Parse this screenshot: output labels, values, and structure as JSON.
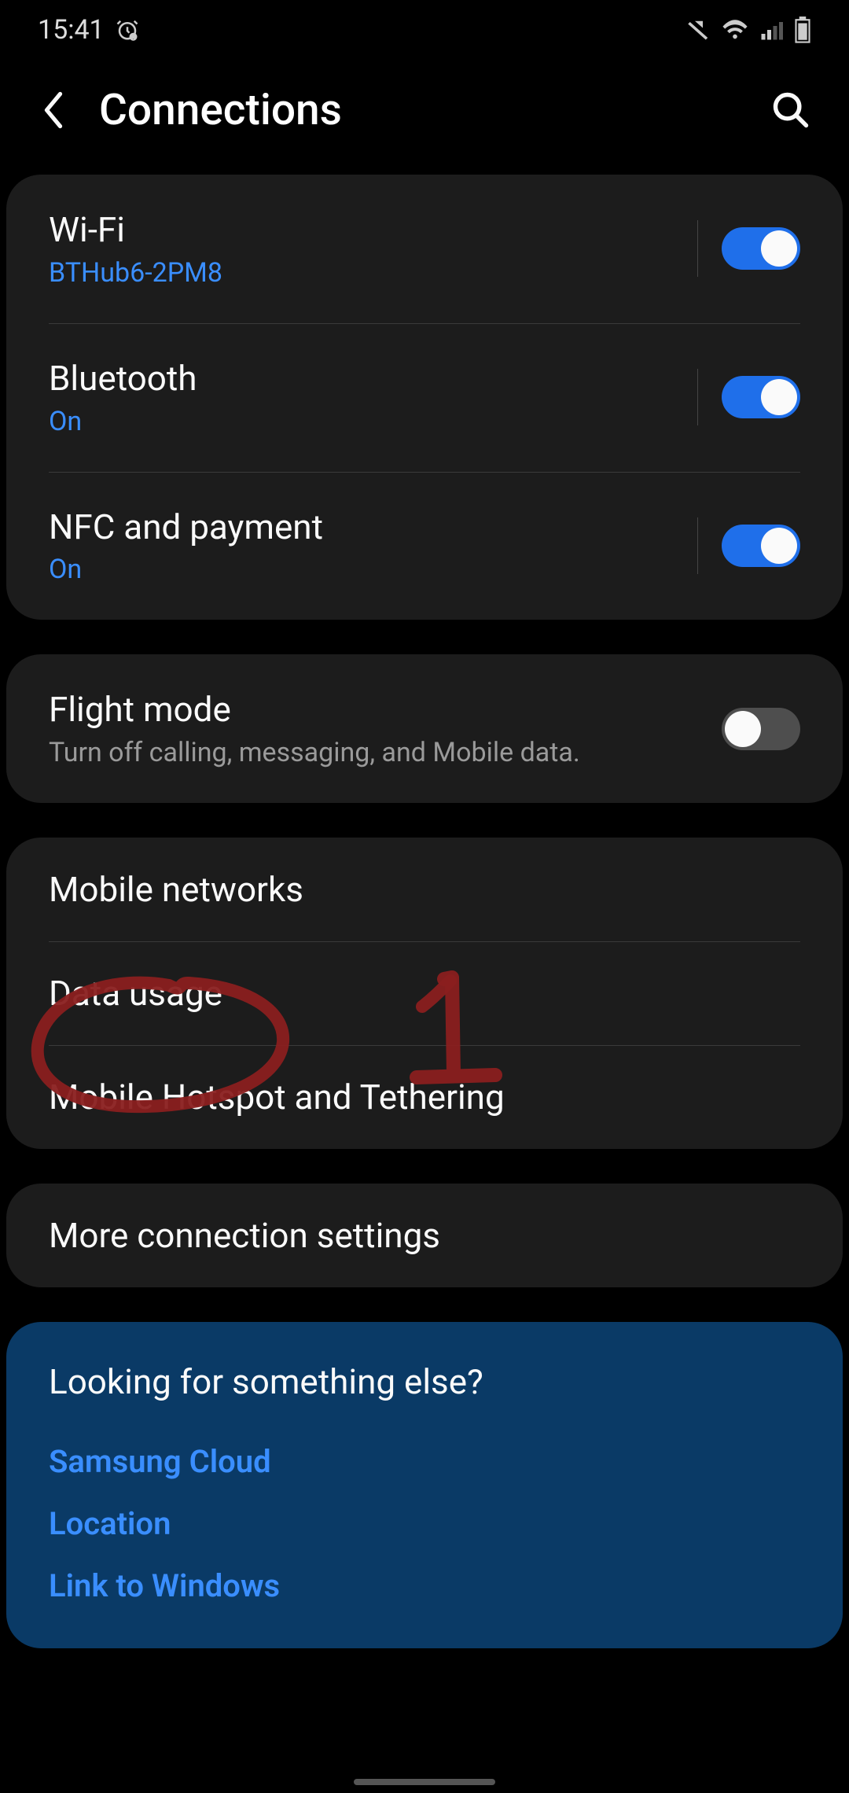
{
  "status": {
    "time": "15:41"
  },
  "header": {
    "title": "Connections"
  },
  "group1": {
    "wifi": {
      "label": "Wi-Fi",
      "sub": "BTHub6-2PM8",
      "on": true
    },
    "bt": {
      "label": "Bluetooth",
      "sub": "On",
      "on": true
    },
    "nfc": {
      "label": "NFC and payment",
      "sub": "On",
      "on": true
    }
  },
  "flight": {
    "label": "Flight mode",
    "sub": "Turn off calling, messaging, and Mobile data.",
    "on": false
  },
  "group3": {
    "mobile_networks": "Mobile networks",
    "data_usage": "Data usage",
    "hotspot": "Mobile Hotspot and Tethering"
  },
  "more": {
    "label": "More connection settings"
  },
  "suggest": {
    "title": "Looking for something else?",
    "links": {
      "samsung_cloud": "Samsung Cloud",
      "location": "Location",
      "link_windows": "Link to Windows"
    }
  },
  "annotation": {
    "circled_item": "Data usage",
    "number_label": "1",
    "color": "#8a1f1f"
  }
}
